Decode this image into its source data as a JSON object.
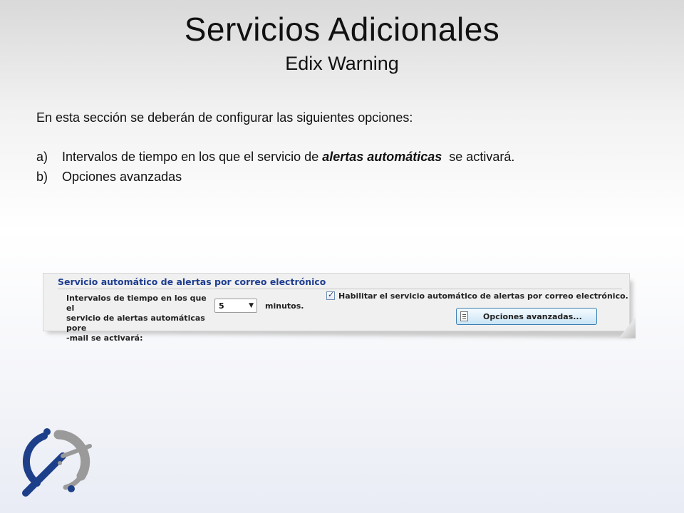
{
  "slide": {
    "title": "Servicios Adicionales",
    "subtitle": "Edix Warning",
    "intro": "En esta sección se deberán de configurar las siguientes opciones:",
    "items": [
      {
        "marker": "a)",
        "before": "Intervalos de tiempo en los que el servicio de ",
        "emphasis": "alertas automáticas",
        "after": "  se activará."
      },
      {
        "marker": "b)",
        "text": "Opciones avanzadas"
      }
    ]
  },
  "panel": {
    "group_title": "Servicio automático de alertas por correo electrónico",
    "interval_label_lines": [
      "Intervalos de tiempo en los que el",
      "servicio de alertas automáticas pore",
      "-mail se activará:"
    ],
    "interval_value": "5",
    "minutes_label": "minutos.",
    "enable_checked": true,
    "enable_label": "Habilitar el servicio automático de alertas por correo electrónico.",
    "advanced_button": "Opciones avanzadas..."
  },
  "colors": {
    "group_title": "#1e3d8f",
    "button_border": "#3c7fb1",
    "logo_blue": "#1d3f8a",
    "logo_gray": "#9a9a9a"
  },
  "icons": {
    "select_arrow": "chevron-down-icon",
    "checkbox": "check-icon",
    "button_icon": "document-list-icon",
    "logo": "edix-logo-icon"
  }
}
